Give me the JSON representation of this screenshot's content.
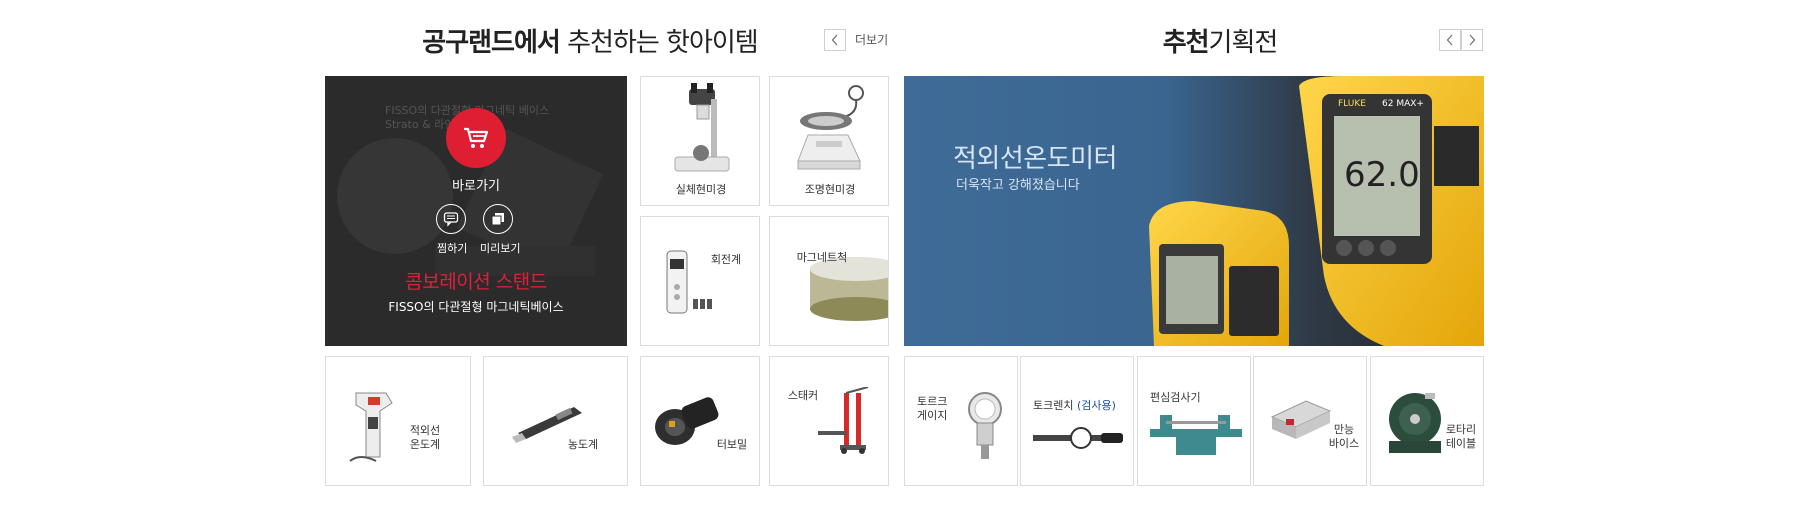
{
  "left_section": {
    "title_bold": "공구랜드에서",
    "title_light": "추천하는 핫아이템",
    "more_label": "더보기",
    "prev_icon": "chevron-left-icon"
  },
  "right_section": {
    "title_bold": "추천",
    "title_light": "기획전",
    "prev_icon": "chevron-left-icon",
    "next_icon": "chevron-right-icon"
  },
  "feature": {
    "bg_text": "FISSO의 다관절형 마그네틱 베이스 Strato & 라인",
    "go_label": "바로가기",
    "wish_label": "찜하기",
    "preview_label": "미리보기",
    "title": "콤보레이션 스탠드",
    "subtitle": "FISSO의 다관절형 마그네틱베이스",
    "accent": "#e01e32"
  },
  "hot_items": [
    {
      "label": "실체현미경",
      "icon": "stereo-microscope-icon"
    },
    {
      "label": "조명현미경",
      "icon": "illuminated-microscope-icon"
    },
    {
      "label": "회전계",
      "icon": "tachometer-icon"
    },
    {
      "label": "마그네트척",
      "icon": "magnetic-chuck-icon"
    }
  ],
  "bottom_left_items": [
    {
      "label_line1": "적외선",
      "label_line2": "온도계",
      "icon": "infrared-thermometer-icon"
    },
    {
      "label_line1": "농도계",
      "label_line2": "",
      "icon": "refractometer-icon"
    },
    {
      "label_line1": "터보밀",
      "label_line2": "",
      "icon": "turbo-mill-icon"
    },
    {
      "label_line1": "스태커",
      "label_line2": "",
      "icon": "stacker-icon"
    }
  ],
  "banner": {
    "title": "적외선온도미터",
    "subtitle": "더욱작고 강해졌습니다",
    "brand": "FLUKE",
    "model": "62 MAX+",
    "display_value": "62.0"
  },
  "bottom_right_items": [
    {
      "label_line1": "토르크",
      "label_line2": "게이지",
      "icon": "torque-gauge-icon"
    },
    {
      "label_line1": "토크렌치",
      "label_sub": "(검사용)",
      "icon": "torque-wrench-icon"
    },
    {
      "label_line1": "편심검사기",
      "label_line2": "",
      "icon": "eccentricity-tester-icon"
    },
    {
      "label_line1": "만능",
      "label_line2": "바이스",
      "icon": "universal-vise-icon"
    },
    {
      "label_line1": "로타리",
      "label_line2": "테이블",
      "icon": "rotary-table-icon"
    }
  ]
}
